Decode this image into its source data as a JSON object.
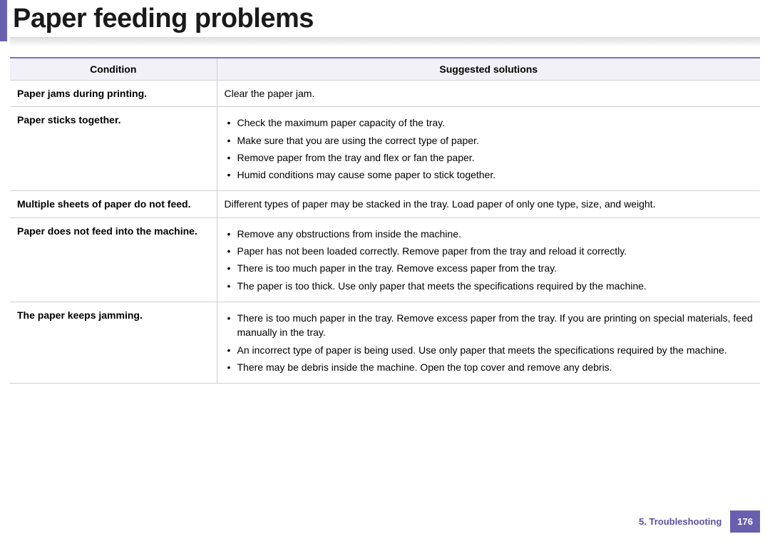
{
  "title": "Paper feeding problems",
  "headers": {
    "condition": "Condition",
    "solutions": "Suggested solutions"
  },
  "rows": [
    {
      "condition": "Paper jams during printing.",
      "solutions_text": "Clear the paper jam."
    },
    {
      "condition": "Paper sticks together.",
      "solutions_list": [
        "Check the maximum paper capacity of the tray.",
        "Make sure that you are using the correct type of paper.",
        "Remove paper from the tray and flex or fan the paper.",
        "Humid conditions may cause some paper to stick together."
      ]
    },
    {
      "condition": "Multiple sheets of paper do not feed.",
      "solutions_text": "Different types of paper may be stacked in the tray. Load paper of only one type, size, and weight."
    },
    {
      "condition": "Paper does not feed into the machine.",
      "solutions_list": [
        "Remove any obstructions from inside the machine.",
        "Paper has not been loaded correctly. Remove paper from the tray and reload it correctly.",
        "There is too much paper in the tray. Remove excess paper from the tray.",
        "The paper is too thick. Use only paper that meets the specifications required by the machine."
      ]
    },
    {
      "condition": "The paper keeps jamming.",
      "solutions_list": [
        "There is too much paper in the tray. Remove excess paper from the tray. If you are printing on special materials, feed manually in the tray.",
        "An incorrect type of paper is being used. Use only paper that meets the specifications required by the machine.",
        "There may be debris inside the machine. Open the top cover and remove any debris."
      ]
    }
  ],
  "footer": {
    "section": "5.  Troubleshooting",
    "page": "176"
  }
}
